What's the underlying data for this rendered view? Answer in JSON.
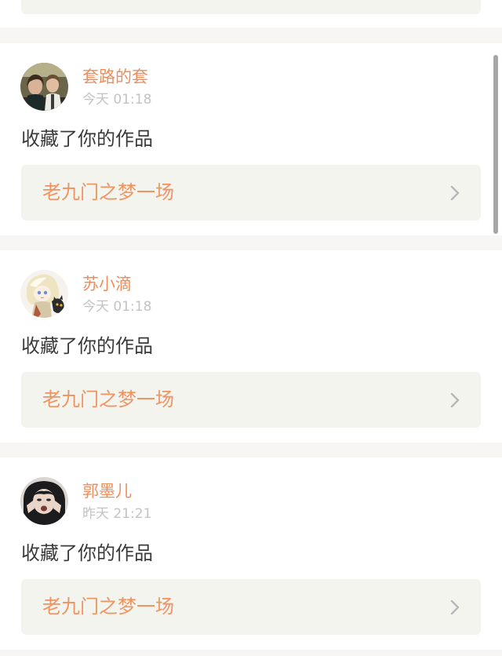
{
  "feed": {
    "items": [
      {
        "username": "套路的套",
        "time": "今天 01:18",
        "action": "收藏了你的作品",
        "work_title": "老九门之梦一场",
        "avatar_icon": "avatar-photo-two-people-icon"
      },
      {
        "username": "苏小滴",
        "time": "今天 01:18",
        "action": "收藏了你的作品",
        "work_title": "老九门之梦一场",
        "avatar_icon": "avatar-anime-character-icon"
      },
      {
        "username": "郭墨儿",
        "time": "昨天 21:21",
        "action": "收藏了你的作品",
        "work_title": "老九门之梦一场",
        "avatar_icon": "avatar-person-face-icon"
      }
    ]
  },
  "colors": {
    "username": "#ef8e5d",
    "work_title": "#ee9463",
    "timestamp": "#c3c3c3",
    "action_text": "#3a3a3a",
    "work_box_bg": "#f4f4ee",
    "page_bg": "#f7f6f4"
  }
}
